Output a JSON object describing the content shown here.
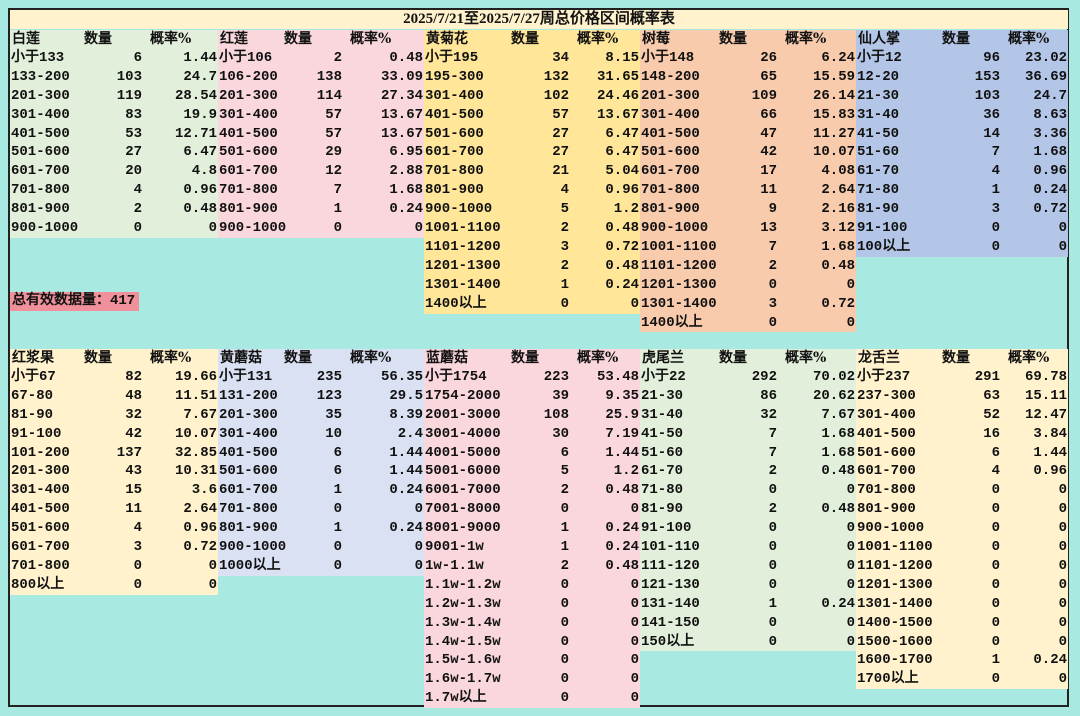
{
  "title": "2025/7/21至2025/7/27周总价格区间概率表",
  "total_label": "总有效数据量：417",
  "headers": {
    "count": "数量",
    "rate": "概率%"
  },
  "colors": {
    "background": "#a8e9e1",
    "title_bg": "#fff2cc",
    "total_bg": "#f0909a"
  },
  "tables": [
    {
      "name": "白莲",
      "color": "#e2efda",
      "section": "top",
      "rows": [
        [
          "小于133",
          "6",
          "1.44"
        ],
        [
          "133-200",
          "103",
          "24.7"
        ],
        [
          "201-300",
          "119",
          "28.54"
        ],
        [
          "301-400",
          "83",
          "19.9"
        ],
        [
          "401-500",
          "53",
          "12.71"
        ],
        [
          "501-600",
          "27",
          "6.47"
        ],
        [
          "601-700",
          "20",
          "4.8"
        ],
        [
          "701-800",
          "4",
          "0.96"
        ],
        [
          "801-900",
          "2",
          "0.48"
        ],
        [
          "900-1000",
          "0",
          "0"
        ]
      ]
    },
    {
      "name": "红莲",
      "color": "#fad7dd",
      "section": "top",
      "rows": [
        [
          "小于106",
          "2",
          "0.48"
        ],
        [
          "106-200",
          "138",
          "33.09"
        ],
        [
          "201-300",
          "114",
          "27.34"
        ],
        [
          "301-400",
          "57",
          "13.67"
        ],
        [
          "401-500",
          "57",
          "13.67"
        ],
        [
          "501-600",
          "29",
          "6.95"
        ],
        [
          "601-700",
          "12",
          "2.88"
        ],
        [
          "701-800",
          "7",
          "1.68"
        ],
        [
          "801-900",
          "1",
          "0.24"
        ],
        [
          "900-1000",
          "0",
          "0"
        ]
      ]
    },
    {
      "name": "黄菊花",
      "color": "#ffe699",
      "section": "top",
      "rows": [
        [
          "小于195",
          "34",
          "8.15"
        ],
        [
          "195-300",
          "132",
          "31.65"
        ],
        [
          "301-400",
          "102",
          "24.46"
        ],
        [
          "401-500",
          "57",
          "13.67"
        ],
        [
          "501-600",
          "27",
          "6.47"
        ],
        [
          "601-700",
          "27",
          "6.47"
        ],
        [
          "701-800",
          "21",
          "5.04"
        ],
        [
          "801-900",
          "4",
          "0.96"
        ],
        [
          "900-1000",
          "5",
          "1.2"
        ],
        [
          "1001-1100",
          "2",
          "0.48"
        ],
        [
          "1101-1200",
          "3",
          "0.72"
        ],
        [
          "1201-1300",
          "2",
          "0.48"
        ],
        [
          "1301-1400",
          "1",
          "0.24"
        ],
        [
          "1400以上",
          "0",
          "0"
        ]
      ]
    },
    {
      "name": "树莓",
      "color": "#f8cbad",
      "section": "top",
      "rows": [
        [
          "小于148",
          "26",
          "6.24"
        ],
        [
          "148-200",
          "65",
          "15.59"
        ],
        [
          "201-300",
          "109",
          "26.14"
        ],
        [
          "301-400",
          "66",
          "15.83"
        ],
        [
          "401-500",
          "47",
          "11.27"
        ],
        [
          "501-600",
          "42",
          "10.07"
        ],
        [
          "601-700",
          "17",
          "4.08"
        ],
        [
          "701-800",
          "11",
          "2.64"
        ],
        [
          "801-900",
          "9",
          "2.16"
        ],
        [
          "900-1000",
          "13",
          "3.12"
        ],
        [
          "1001-1100",
          "7",
          "1.68"
        ],
        [
          "1101-1200",
          "2",
          "0.48"
        ],
        [
          "1201-1300",
          "0",
          "0"
        ],
        [
          "1301-1400",
          "3",
          "0.72"
        ],
        [
          "1400以上",
          "0",
          "0"
        ]
      ]
    },
    {
      "name": "仙人掌",
      "color": "#b4c6e7",
      "section": "top",
      "rows": [
        [
          "小于12",
          "96",
          "23.02"
        ],
        [
          "12-20",
          "153",
          "36.69"
        ],
        [
          "21-30",
          "103",
          "24.7"
        ],
        [
          "31-40",
          "36",
          "8.63"
        ],
        [
          "41-50",
          "14",
          "3.36"
        ],
        [
          "51-60",
          "7",
          "1.68"
        ],
        [
          "61-70",
          "4",
          "0.96"
        ],
        [
          "71-80",
          "1",
          "0.24"
        ],
        [
          "81-90",
          "3",
          "0.72"
        ],
        [
          "91-100",
          "0",
          "0"
        ],
        [
          "100以上",
          "0",
          "0"
        ]
      ]
    },
    {
      "name": "红浆果",
      "color": "#fff2cc",
      "section": "bottom",
      "rows": [
        [
          "小于67",
          "82",
          "19.66"
        ],
        [
          "67-80",
          "48",
          "11.51"
        ],
        [
          "81-90",
          "32",
          "7.67"
        ],
        [
          "91-100",
          "42",
          "10.07"
        ],
        [
          "101-200",
          "137",
          "32.85"
        ],
        [
          "201-300",
          "43",
          "10.31"
        ],
        [
          "301-400",
          "15",
          "3.6"
        ],
        [
          "401-500",
          "11",
          "2.64"
        ],
        [
          "501-600",
          "4",
          "0.96"
        ],
        [
          "601-700",
          "3",
          "0.72"
        ],
        [
          "701-800",
          "0",
          "0"
        ],
        [
          "800以上",
          "0",
          "0"
        ]
      ]
    },
    {
      "name": "黄蘑菇",
      "color": "#d9e1f2",
      "section": "bottom",
      "rows": [
        [
          "小于131",
          "235",
          "56.35"
        ],
        [
          "131-200",
          "123",
          "29.5"
        ],
        [
          "201-300",
          "35",
          "8.39"
        ],
        [
          "301-400",
          "10",
          "2.4"
        ],
        [
          "401-500",
          "6",
          "1.44"
        ],
        [
          "501-600",
          "6",
          "1.44"
        ],
        [
          "601-700",
          "1",
          "0.24"
        ],
        [
          "701-800",
          "0",
          "0"
        ],
        [
          "801-900",
          "1",
          "0.24"
        ],
        [
          "900-1000",
          "0",
          "0"
        ],
        [
          "1000以上",
          "0",
          "0"
        ]
      ]
    },
    {
      "name": "蓝蘑菇",
      "color": "#fad7dd",
      "section": "bottom",
      "rows": [
        [
          "小于1754",
          "223",
          "53.48"
        ],
        [
          "1754-2000",
          "39",
          "9.35"
        ],
        [
          "2001-3000",
          "108",
          "25.9"
        ],
        [
          "3001-4000",
          "30",
          "7.19"
        ],
        [
          "4001-5000",
          "6",
          "1.44"
        ],
        [
          "5001-6000",
          "5",
          "1.2"
        ],
        [
          "6001-7000",
          "2",
          "0.48"
        ],
        [
          "7001-8000",
          "0",
          "0"
        ],
        [
          "8001-9000",
          "1",
          "0.24"
        ],
        [
          "9001-1w",
          "1",
          "0.24"
        ],
        [
          "1w-1.1w",
          "2",
          "0.48"
        ],
        [
          "1.1w-1.2w",
          "0",
          "0"
        ],
        [
          "1.2w-1.3w",
          "0",
          "0"
        ],
        [
          "1.3w-1.4w",
          "0",
          "0"
        ],
        [
          "1.4w-1.5w",
          "0",
          "0"
        ],
        [
          "1.5w-1.6w",
          "0",
          "0"
        ],
        [
          "1.6w-1.7w",
          "0",
          "0"
        ],
        [
          "1.7w以上",
          "0",
          "0"
        ]
      ]
    },
    {
      "name": "虎尾兰",
      "color": "#e2efda",
      "section": "bottom",
      "rows": [
        [
          "小于22",
          "292",
          "70.02"
        ],
        [
          "21-30",
          "86",
          "20.62"
        ],
        [
          "31-40",
          "32",
          "7.67"
        ],
        [
          "41-50",
          "7",
          "1.68"
        ],
        [
          "51-60",
          "7",
          "1.68"
        ],
        [
          "61-70",
          "2",
          "0.48"
        ],
        [
          "71-80",
          "0",
          "0"
        ],
        [
          "81-90",
          "2",
          "0.48"
        ],
        [
          "91-100",
          "0",
          "0"
        ],
        [
          "101-110",
          "0",
          "0"
        ],
        [
          "111-120",
          "0",
          "0"
        ],
        [
          "121-130",
          "0",
          "0"
        ],
        [
          "131-140",
          "1",
          "0.24"
        ],
        [
          "141-150",
          "0",
          "0"
        ],
        [
          "150以上",
          "0",
          "0"
        ]
      ]
    },
    {
      "name": "龙舌兰",
      "color": "#fff2cc",
      "section": "bottom",
      "rows": [
        [
          "小于237",
          "291",
          "69.78"
        ],
        [
          "237-300",
          "63",
          "15.11"
        ],
        [
          "301-400",
          "52",
          "12.47"
        ],
        [
          "401-500",
          "16",
          "3.84"
        ],
        [
          "501-600",
          "6",
          "1.44"
        ],
        [
          "601-700",
          "4",
          "0.96"
        ],
        [
          "701-800",
          "0",
          "0"
        ],
        [
          "801-900",
          "0",
          "0"
        ],
        [
          "900-1000",
          "0",
          "0"
        ],
        [
          "1001-1100",
          "0",
          "0"
        ],
        [
          "1101-1200",
          "0",
          "0"
        ],
        [
          "1201-1300",
          "0",
          "0"
        ],
        [
          "1301-1400",
          "0",
          "0"
        ],
        [
          "1400-1500",
          "0",
          "0"
        ],
        [
          "1500-1600",
          "0",
          "0"
        ],
        [
          "1600-1700",
          "1",
          "0.24"
        ],
        [
          "1700以上",
          "0",
          "0"
        ]
      ]
    }
  ]
}
